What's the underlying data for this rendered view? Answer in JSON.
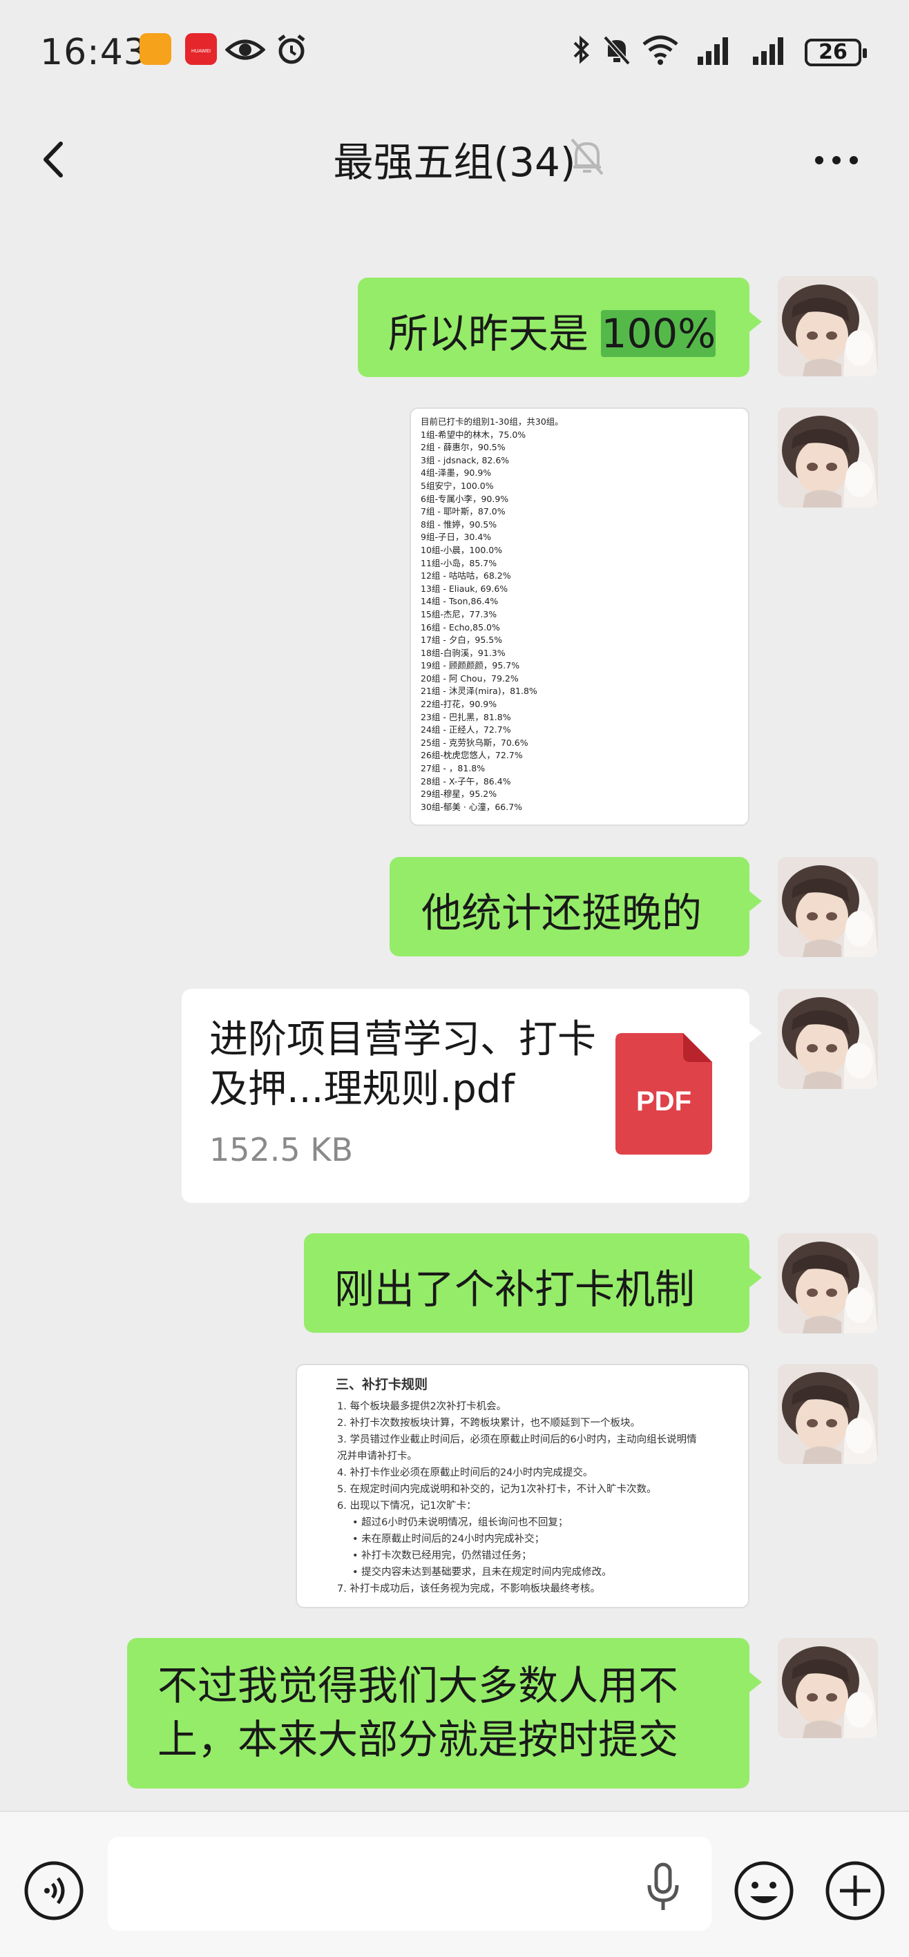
{
  "status_bar": {
    "time": "16:43",
    "app_badge": "HUAWEI",
    "battery": "26",
    "icons": [
      "app-icon",
      "huawei-app-icon",
      "eye-icon",
      "alarm-icon",
      "bluetooth-icon",
      "mute-icon",
      "wifi-icon",
      "signal-icon",
      "signal-icon",
      "battery-icon"
    ]
  },
  "header": {
    "title": "最强五组(34)",
    "back_icon": "back-arrow-icon",
    "mute_icon": "muted-bell-icon",
    "more_icon": "more-icon"
  },
  "messages": [
    {
      "type": "text",
      "text_pre": "所以昨天是 ",
      "text_highlight": "100%"
    },
    {
      "type": "image",
      "lines": [
        "目前已打卡的组别1-30组，共30组。",
        "1组-希望中的林木，75.0%",
        "2组 - 薛惠尔，90.5%",
        "3组 - jdsnack, 82.6%",
        "4组-泽墨，90.9%",
        "5组安宁，100.0%",
        "6组-专属小李，90.9%",
        "7组 - 耶叶斯，87.0%",
        "8组 - 惟婷，90.5%",
        "9组-子日，30.4%",
        "10组-小晨，100.0%",
        "11组-小岛，85.7%",
        "12组 - 咕咕咕，68.2%",
        "13组 - Eliauk, 69.6%",
        "14组 - Tson,86.4%",
        "15组-杰尼，77.3%",
        "16组 - Echo,85.0%",
        "17组 - 夕白，95.5%",
        "18组-白驹溪，91.3%",
        "19组 - 顾颜颜颜，95.7%",
        "20组 - 阿 Chou，79.2%",
        "21组 - 沐灵泽(mira)，81.8%",
        "22组-打花，90.9%",
        "23组 - 巴扎黑，81.8%",
        "24组 - 正经人，72.7%",
        "25组 - 克劳狄乌斯，70.6%",
        "26组-枕虎您悠人，72.7%",
        "27组 - ，81.8%",
        "28组 - X-子午，86.4%",
        "29组-穆星，95.2%",
        "30组-郁美 · 心潼，66.7%"
      ]
    },
    {
      "type": "text",
      "text": "他统计还挺晚的"
    },
    {
      "type": "file",
      "name": "进阶项目营学习、打卡及押...理规则.pdf",
      "size": "152.5 KB",
      "badge": "PDF"
    },
    {
      "type": "text",
      "text": "刚出了个补打卡机制"
    },
    {
      "type": "image",
      "title": "三、补打卡规则",
      "lines": [
        "1. 每个板块最多提供2次补打卡机会。",
        "2. 补打卡次数按板块计算，不跨板块累计，也不顺延到下一个板块。",
        "3. 学员错过作业截止时间后，必须在原截止时间后的6小时内，主动向组长说明情",
        "   况并申请补打卡。",
        "4. 补打卡作业必须在原截止时间后的24小时内完成提交。",
        "5. 在规定时间内完成说明和补交的，记为1次补打卡，不计入旷卡次数。",
        "6. 出现以下情况，记1次旷卡：",
        "• 超过6小时仍未说明情况，组长询问也不回复；",
        "• 未在原截止时间后的24小时内完成补交；",
        "• 补打卡次数已经用完，仍然错过任务；",
        "• 提交内容未达到基础要求，且未在规定时间内完成修改。",
        "7. 补打卡成功后，该任务视为完成，不影响板块最终考核。"
      ]
    },
    {
      "type": "text",
      "text": "不过我觉得我们大多数人用不上，本来大部分就是按时提交"
    }
  ],
  "input_bar": {
    "voice_icon": "voice-icon",
    "mic_icon": "microphone-icon",
    "emoji_icon": "emoji-icon",
    "plus_icon": "plus-icon"
  },
  "colors": {
    "bubble_green": "#95ec69",
    "highlight": "#55b94a",
    "background": "#ededed",
    "pdf_red": "#e0424a"
  }
}
